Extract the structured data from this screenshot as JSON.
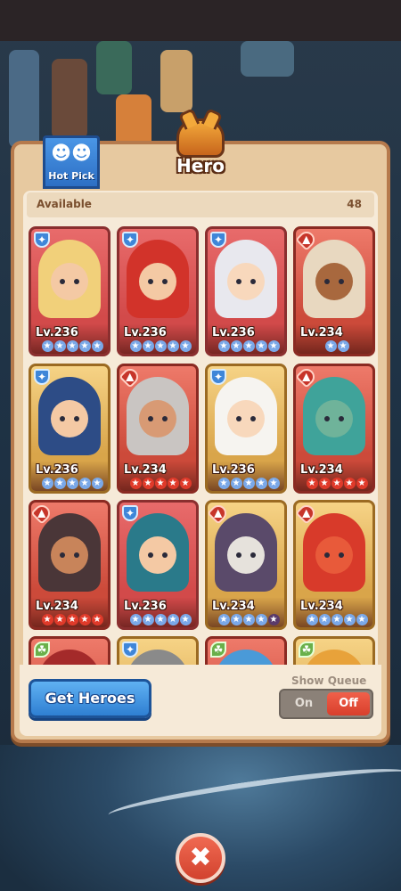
{
  "title": "Hero",
  "hot_pick": {
    "label": "Hot Pick"
  },
  "available": {
    "label": "Available",
    "count": "48"
  },
  "heroes": [
    {
      "level": "Lv.236",
      "faction": "shield",
      "stars": [
        "white",
        "white",
        "white",
        "white",
        "white"
      ],
      "theme": "blue",
      "hair": "#f1d07a",
      "skin": "#f4c9a4"
    },
    {
      "level": "Lv.236",
      "faction": "shield",
      "stars": [
        "white",
        "white",
        "white",
        "white",
        "white"
      ],
      "theme": "blue",
      "hair": "#d2332a",
      "skin": "#f4c9a4"
    },
    {
      "level": "Lv.236",
      "faction": "shield",
      "stars": [
        "white",
        "white",
        "white",
        "white",
        "white"
      ],
      "theme": "blue",
      "hair": "#e8e8ee",
      "skin": "#f8d8bc"
    },
    {
      "level": "Lv.234",
      "faction": "flame",
      "stars": [
        "white",
        "white"
      ],
      "theme": "red",
      "hair": "#e8d8c0",
      "skin": "#a8683e"
    },
    {
      "level": "Lv.236",
      "faction": "shield",
      "stars": [
        "white",
        "white",
        "white",
        "white",
        "white"
      ],
      "theme": "gold",
      "hair": "#2d4c86",
      "skin": "#f4c9a4"
    },
    {
      "level": "Lv.234",
      "faction": "flame",
      "stars": [
        "red",
        "red",
        "red",
        "red",
        "red"
      ],
      "theme": "red",
      "hair": "#c9c5c2",
      "skin": "#d89a74"
    },
    {
      "level": "Lv.236",
      "faction": "shield",
      "stars": [
        "white",
        "white",
        "white",
        "white",
        "white"
      ],
      "theme": "gold",
      "hair": "#f6f4f0",
      "skin": "#f8d8bc"
    },
    {
      "level": "Lv.234",
      "faction": "flame",
      "stars": [
        "red",
        "red",
        "red",
        "red",
        "red"
      ],
      "theme": "red",
      "hair": "#3fa39a",
      "skin": "#6fb39a"
    },
    {
      "level": "Lv.234",
      "faction": "flame",
      "stars": [
        "red",
        "red",
        "red",
        "red",
        "red"
      ],
      "theme": "red",
      "hair": "#4a3638",
      "skin": "#c8845a"
    },
    {
      "level": "Lv.236",
      "faction": "shield",
      "stars": [
        "white",
        "white",
        "white",
        "white",
        "white"
      ],
      "theme": "blue",
      "hair": "#2a7a8a",
      "skin": "#f4c9a4"
    },
    {
      "level": "Lv.234",
      "faction": "flame",
      "stars": [
        "white",
        "white",
        "white",
        "white",
        "dark"
      ],
      "theme": "gold",
      "hair": "#5a4a6a",
      "skin": "#e6e2dc"
    },
    {
      "level": "Lv.234",
      "faction": "flame",
      "stars": [
        "white",
        "white",
        "white",
        "white",
        "white"
      ],
      "theme": "gold",
      "hair": "#d83a2a",
      "skin": "#e85a3a"
    },
    {
      "level": "",
      "faction": "leaf",
      "stars": [],
      "theme": "red",
      "hair": "#a42a2a",
      "skin": "#d86a4a"
    },
    {
      "level": "",
      "faction": "shield",
      "stars": [],
      "theme": "gold",
      "hair": "#8a8a8a",
      "skin": "#b0a090"
    },
    {
      "level": "",
      "faction": "leaf",
      "stars": [],
      "theme": "red",
      "hair": "#4a9ad8",
      "skin": "#f4c9a4"
    },
    {
      "level": "",
      "faction": "leaf",
      "stars": [],
      "theme": "gold",
      "hair": "#e8a23a",
      "skin": "#f0c070"
    }
  ],
  "footer": {
    "get_heroes": "Get Heroes",
    "show_queue": "Show Queue",
    "on": "On",
    "off": "Off"
  },
  "close_icon": "close-icon"
}
